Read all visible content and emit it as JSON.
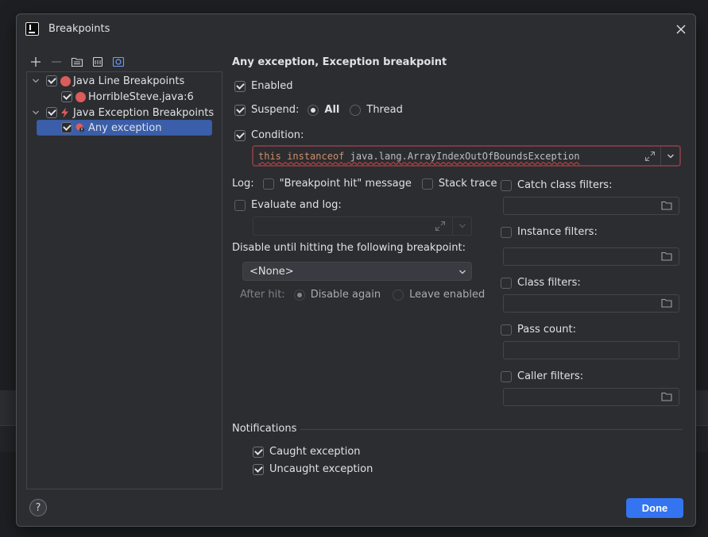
{
  "window": {
    "title": "Breakpoints"
  },
  "tree": {
    "items": [
      {
        "label": "Java Line Breakpoints",
        "checked": true
      },
      {
        "label": "HorribleSteve.java:6",
        "checked": true
      },
      {
        "label": "Java Exception Breakpoints",
        "checked": true
      },
      {
        "label": "Any exception",
        "checked": true,
        "selected": true
      }
    ]
  },
  "detail": {
    "heading": "Any exception, Exception breakpoint",
    "enabled_label": "Enabled",
    "suspend_label": "Suspend:",
    "suspend_all": "All",
    "suspend_thread": "Thread",
    "condition_label": "Condition:",
    "condition_value": {
      "kw1": "this",
      "kw2": "instanceof",
      "cls": "java.lang.ArrayIndexOutOfBoundsException"
    },
    "log_label": "Log:",
    "log_message": "\"Breakpoint hit\" message",
    "log_stack": "Stack trace",
    "evaluate_label": "Evaluate and log:",
    "disable_until_label": "Disable until hitting the following breakpoint:",
    "disable_until_value": "<None>",
    "after_hit_label": "After hit:",
    "after_hit_disable": "Disable again",
    "after_hit_leave": "Leave enabled",
    "filters": {
      "catch": "Catch class filters:",
      "instance": "Instance filters:",
      "class": "Class filters:",
      "pass": "Pass count:",
      "caller": "Caller filters:"
    },
    "notifications_label": "Notifications",
    "caught": "Caught exception",
    "uncaught": "Uncaught exception"
  },
  "footer": {
    "done": "Done",
    "help": "?"
  },
  "colors": {
    "accent": "#3574f0",
    "breakpoint": "#db5c5c",
    "error_border": "#7a3a44"
  }
}
